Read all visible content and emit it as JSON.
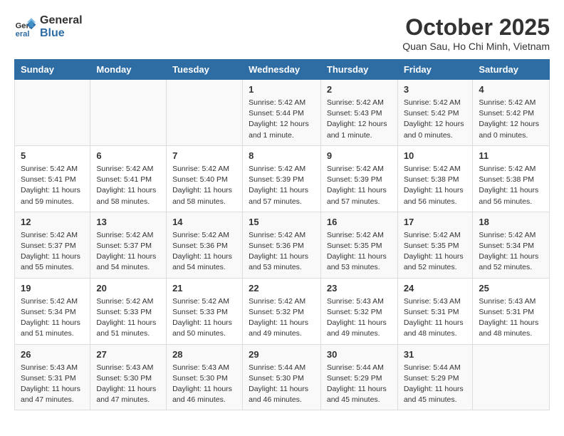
{
  "header": {
    "logo_general": "General",
    "logo_blue": "Blue",
    "main_title": "October 2025",
    "subtitle": "Quan Sau, Ho Chi Minh, Vietnam"
  },
  "days_of_week": [
    "Sunday",
    "Monday",
    "Tuesday",
    "Wednesday",
    "Thursday",
    "Friday",
    "Saturday"
  ],
  "weeks": [
    {
      "cells": [
        {
          "day": "",
          "detail": ""
        },
        {
          "day": "",
          "detail": ""
        },
        {
          "day": "",
          "detail": ""
        },
        {
          "day": "1",
          "detail": "Sunrise: 5:42 AM\nSunset: 5:44 PM\nDaylight: 12 hours\nand 1 minute."
        },
        {
          "day": "2",
          "detail": "Sunrise: 5:42 AM\nSunset: 5:43 PM\nDaylight: 12 hours\nand 1 minute."
        },
        {
          "day": "3",
          "detail": "Sunrise: 5:42 AM\nSunset: 5:42 PM\nDaylight: 12 hours\nand 0 minutes."
        },
        {
          "day": "4",
          "detail": "Sunrise: 5:42 AM\nSunset: 5:42 PM\nDaylight: 12 hours\nand 0 minutes."
        }
      ]
    },
    {
      "cells": [
        {
          "day": "5",
          "detail": "Sunrise: 5:42 AM\nSunset: 5:41 PM\nDaylight: 11 hours\nand 59 minutes."
        },
        {
          "day": "6",
          "detail": "Sunrise: 5:42 AM\nSunset: 5:41 PM\nDaylight: 11 hours\nand 58 minutes."
        },
        {
          "day": "7",
          "detail": "Sunrise: 5:42 AM\nSunset: 5:40 PM\nDaylight: 11 hours\nand 58 minutes."
        },
        {
          "day": "8",
          "detail": "Sunrise: 5:42 AM\nSunset: 5:39 PM\nDaylight: 11 hours\nand 57 minutes."
        },
        {
          "day": "9",
          "detail": "Sunrise: 5:42 AM\nSunset: 5:39 PM\nDaylight: 11 hours\nand 57 minutes."
        },
        {
          "day": "10",
          "detail": "Sunrise: 5:42 AM\nSunset: 5:38 PM\nDaylight: 11 hours\nand 56 minutes."
        },
        {
          "day": "11",
          "detail": "Sunrise: 5:42 AM\nSunset: 5:38 PM\nDaylight: 11 hours\nand 56 minutes."
        }
      ]
    },
    {
      "cells": [
        {
          "day": "12",
          "detail": "Sunrise: 5:42 AM\nSunset: 5:37 PM\nDaylight: 11 hours\nand 55 minutes."
        },
        {
          "day": "13",
          "detail": "Sunrise: 5:42 AM\nSunset: 5:37 PM\nDaylight: 11 hours\nand 54 minutes."
        },
        {
          "day": "14",
          "detail": "Sunrise: 5:42 AM\nSunset: 5:36 PM\nDaylight: 11 hours\nand 54 minutes."
        },
        {
          "day": "15",
          "detail": "Sunrise: 5:42 AM\nSunset: 5:36 PM\nDaylight: 11 hours\nand 53 minutes."
        },
        {
          "day": "16",
          "detail": "Sunrise: 5:42 AM\nSunset: 5:35 PM\nDaylight: 11 hours\nand 53 minutes."
        },
        {
          "day": "17",
          "detail": "Sunrise: 5:42 AM\nSunset: 5:35 PM\nDaylight: 11 hours\nand 52 minutes."
        },
        {
          "day": "18",
          "detail": "Sunrise: 5:42 AM\nSunset: 5:34 PM\nDaylight: 11 hours\nand 52 minutes."
        }
      ]
    },
    {
      "cells": [
        {
          "day": "19",
          "detail": "Sunrise: 5:42 AM\nSunset: 5:34 PM\nDaylight: 11 hours\nand 51 minutes."
        },
        {
          "day": "20",
          "detail": "Sunrise: 5:42 AM\nSunset: 5:33 PM\nDaylight: 11 hours\nand 51 minutes."
        },
        {
          "day": "21",
          "detail": "Sunrise: 5:42 AM\nSunset: 5:33 PM\nDaylight: 11 hours\nand 50 minutes."
        },
        {
          "day": "22",
          "detail": "Sunrise: 5:42 AM\nSunset: 5:32 PM\nDaylight: 11 hours\nand 49 minutes."
        },
        {
          "day": "23",
          "detail": "Sunrise: 5:43 AM\nSunset: 5:32 PM\nDaylight: 11 hours\nand 49 minutes."
        },
        {
          "day": "24",
          "detail": "Sunrise: 5:43 AM\nSunset: 5:31 PM\nDaylight: 11 hours\nand 48 minutes."
        },
        {
          "day": "25",
          "detail": "Sunrise: 5:43 AM\nSunset: 5:31 PM\nDaylight: 11 hours\nand 48 minutes."
        }
      ]
    },
    {
      "cells": [
        {
          "day": "26",
          "detail": "Sunrise: 5:43 AM\nSunset: 5:31 PM\nDaylight: 11 hours\nand 47 minutes."
        },
        {
          "day": "27",
          "detail": "Sunrise: 5:43 AM\nSunset: 5:30 PM\nDaylight: 11 hours\nand 47 minutes."
        },
        {
          "day": "28",
          "detail": "Sunrise: 5:43 AM\nSunset: 5:30 PM\nDaylight: 11 hours\nand 46 minutes."
        },
        {
          "day": "29",
          "detail": "Sunrise: 5:44 AM\nSunset: 5:30 PM\nDaylight: 11 hours\nand 46 minutes."
        },
        {
          "day": "30",
          "detail": "Sunrise: 5:44 AM\nSunset: 5:29 PM\nDaylight: 11 hours\nand 45 minutes."
        },
        {
          "day": "31",
          "detail": "Sunrise: 5:44 AM\nSunset: 5:29 PM\nDaylight: 11 hours\nand 45 minutes."
        },
        {
          "day": "",
          "detail": ""
        }
      ]
    }
  ]
}
